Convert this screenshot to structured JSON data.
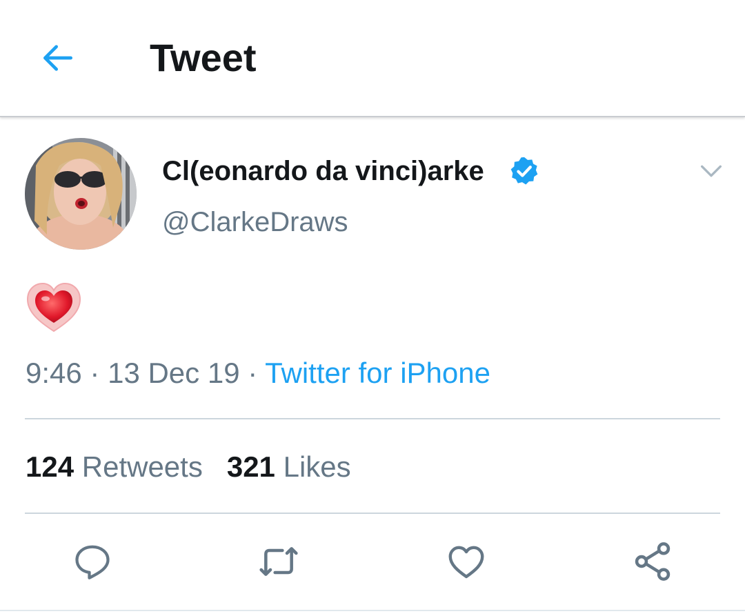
{
  "header": {
    "title": "Tweet",
    "back_icon": "arrow-left-icon"
  },
  "tweet": {
    "author_name": "Cl(eonardo da vinci)arke",
    "author_handle": "@ClarkeDraws",
    "verified_icon": "verified-badge-icon",
    "text_emoji": "heart-emoji",
    "time": "9:46",
    "date": "13 Dec 19",
    "separator": "·",
    "source": "Twitter for iPhone"
  },
  "stats": {
    "retweets_count": "124",
    "retweets_label": "Retweets",
    "likes_count": "321",
    "likes_label": "Likes"
  },
  "actions": [
    "reply-icon",
    "retweet-icon",
    "like-icon",
    "share-icon"
  ],
  "colors": {
    "accent": "#1da1f2",
    "text_primary": "#14171a",
    "text_secondary": "#657786",
    "divider": "#ccd6dd"
  }
}
